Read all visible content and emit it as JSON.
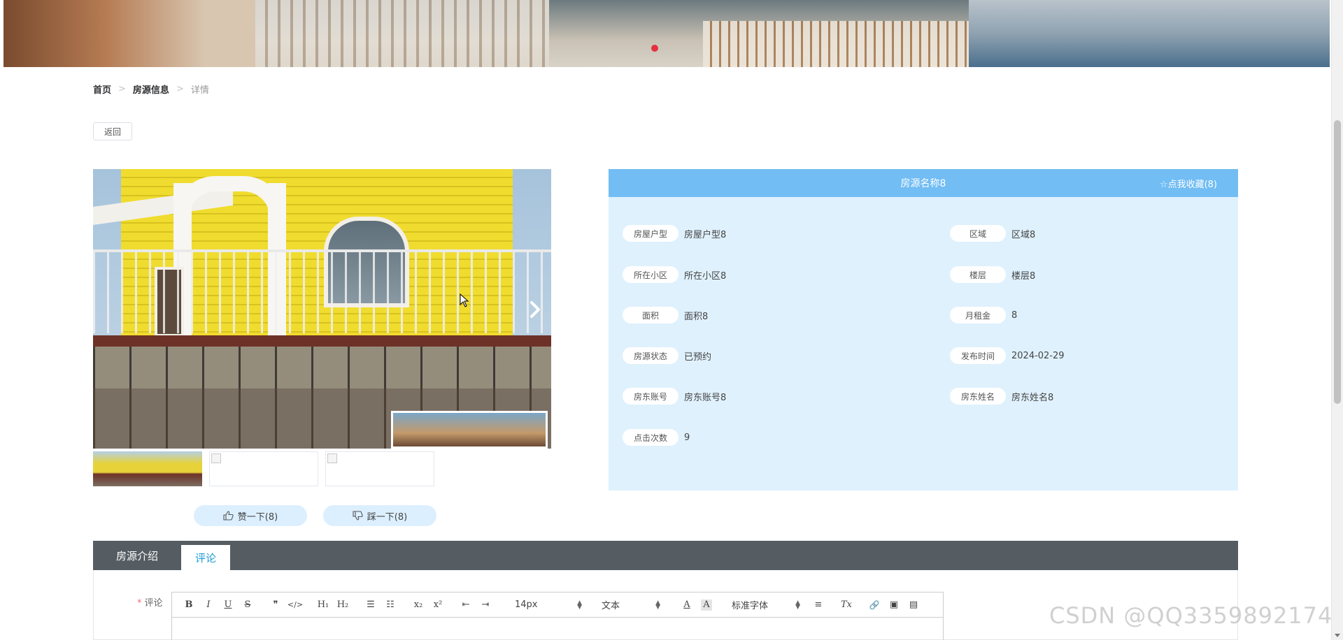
{
  "breadcrumb": {
    "home": "首页",
    "section": "房源信息",
    "current": "详情",
    "separator": ">"
  },
  "back_button": "返回",
  "property": {
    "title": "房源名称8",
    "favorite": "☆点我收藏(8)",
    "fields": [
      {
        "label": "房屋户型",
        "value": "房屋户型8"
      },
      {
        "label": "区域",
        "value": "区域8"
      },
      {
        "label": "所在小区",
        "value": "所在小区8"
      },
      {
        "label": "楼层",
        "value": "楼层8"
      },
      {
        "label": "面积",
        "value": "面积8"
      },
      {
        "label": "月租金",
        "value": "8"
      },
      {
        "label": "房源状态",
        "value": "已预约"
      },
      {
        "label": "发布时间",
        "value": "2024-02-29"
      },
      {
        "label": "房东账号",
        "value": "房东账号8"
      },
      {
        "label": "房东姓名",
        "value": "房东姓名8"
      },
      {
        "label": "点击次数",
        "value": "9"
      }
    ]
  },
  "votes": {
    "up": "赞一下(8)",
    "down": "踩一下(8)"
  },
  "tabs": [
    {
      "label": "房源介绍"
    },
    {
      "label": "评论"
    }
  ],
  "comment": {
    "label": "评论",
    "required_mark": "*",
    "toolbar": {
      "bold": "B",
      "italic": "I",
      "underline": "U",
      "strike": "S",
      "quote": "❞",
      "code": "</>",
      "h1": "H₁",
      "h2": "H₂",
      "ordered_list": "☰",
      "bullet_list": "☷",
      "subscript": "x₂",
      "superscript": "x²",
      "outdent": "⇤",
      "indent": "⇥",
      "size": "14px",
      "block": "文本",
      "font": "标准字体",
      "color": "A",
      "background": "A",
      "align": "≡",
      "clear": "Tx",
      "link": "🔗",
      "image": "▣",
      "video": "▤"
    }
  },
  "watermark": "CSDN @QQ3359892174",
  "colors": {
    "header": "#71bdf4",
    "panel": "#dff1fd",
    "tab_bar": "#555d63",
    "active_tab_text": "#1e9bd7",
    "vote_bg": "#dcefff"
  }
}
